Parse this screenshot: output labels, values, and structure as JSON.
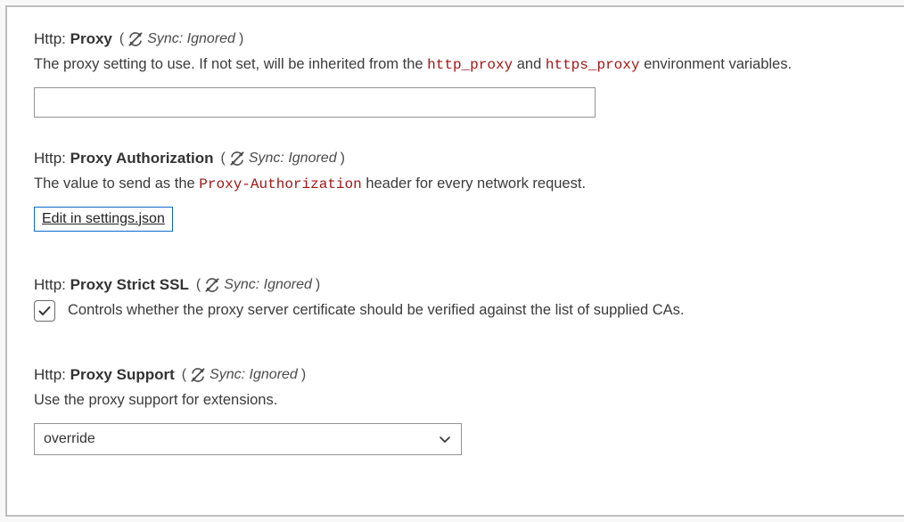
{
  "sync_label": "Sync: Ignored",
  "settings": {
    "proxy": {
      "category": "Http:",
      "name": "Proxy",
      "desc_prefix": "The proxy setting to use. If not set, will be inherited from the ",
      "desc_code1": "http_proxy",
      "desc_mid": " and ",
      "desc_code2": "https_proxy",
      "desc_suffix": " environment variables.",
      "value": ""
    },
    "proxyAuth": {
      "category": "Http:",
      "name": "Proxy Authorization",
      "desc_prefix": "The value to send as the ",
      "desc_code1": "Proxy-Authorization",
      "desc_suffix": " header for every network request.",
      "edit_label": "Edit in settings.json"
    },
    "proxyStrictSSL": {
      "category": "Http:",
      "name": "Proxy Strict SSL",
      "checkbox_label": "Controls whether the proxy server certificate should be verified against the list of supplied CAs.",
      "checked": true
    },
    "proxySupport": {
      "category": "Http:",
      "name": "Proxy Support",
      "desc": "Use the proxy support for extensions.",
      "value": "override"
    }
  }
}
